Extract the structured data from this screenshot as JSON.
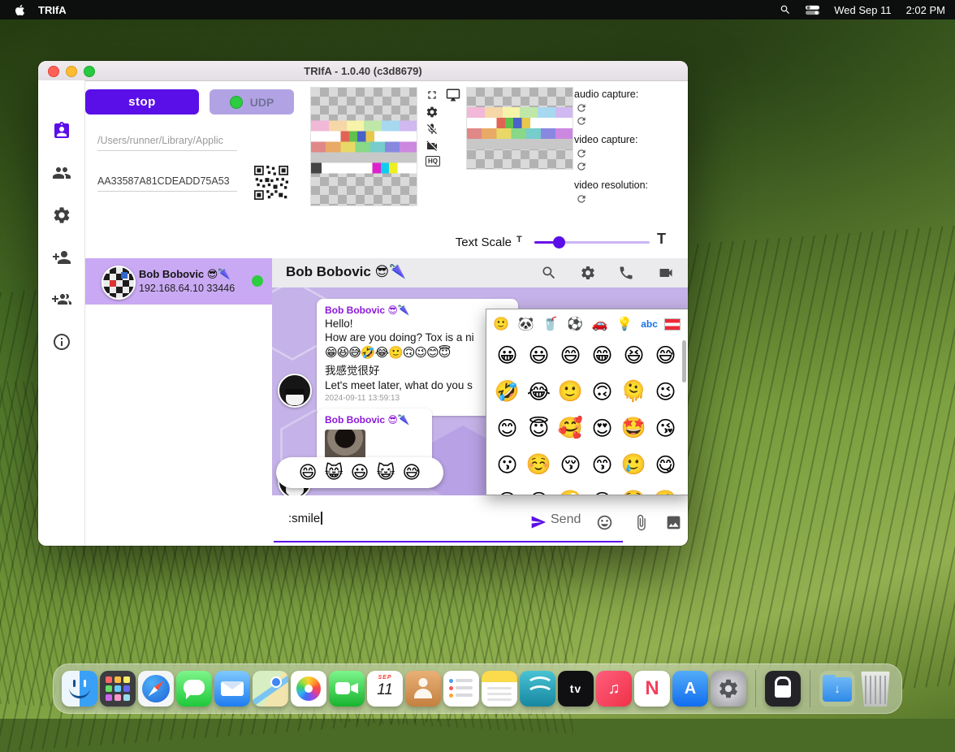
{
  "menubar": {
    "app_name": "TRIfA",
    "date": "Wed Sep 11",
    "time": "2:02 PM"
  },
  "window_title": "TRIfA - 1.0.40 (c3d8679)",
  "toolbar": {
    "stop_label": "stop",
    "udp_label": "UDP",
    "path_value": "/Users/runner/Library/Applic",
    "toxid_value": "AA33587A81CDEADD75A53",
    "hq_label": "HQ",
    "audio_capture_label": "audio capture:",
    "video_capture_label": "video capture:",
    "video_resolution_label": "video resolution:",
    "text_scale_label": "Text Scale",
    "text_scale_small": "T",
    "text_scale_large": "T"
  },
  "contact": {
    "name": "Bob Bobovic 😎🌂",
    "address": "192.168.64.10 33446"
  },
  "chat": {
    "title": "Bob Bobovic 😎🌂",
    "message1": {
      "sender": "Bob Bobovic 😎🌂",
      "line1": "Hello!",
      "line2": "How are you doing? Tox is a ni",
      "emoji_line": "😁😆😅🤣😂🙂🙃😉😊😇",
      "line3": "我感觉很好",
      "line4": "Let's meet later, what do you s",
      "timestamp": "2024-09-11 13:59:13"
    },
    "message2": {
      "sender": "Bob Bobovic 😎🌂"
    },
    "suggestions": [
      "😄",
      "😸",
      "😃",
      "😺",
      "😅"
    ],
    "input_value": ":smile",
    "send_label": "Send"
  },
  "emoji_picker": {
    "categories": [
      "🙂",
      "🐼",
      "🥤",
      "⚽",
      "🚗",
      "💡",
      "abc",
      "austria-flag"
    ],
    "rows": [
      [
        "😀",
        "😃",
        "😄",
        "😁",
        "😆",
        "😅"
      ],
      [
        "🤣",
        "😂",
        "🙂",
        "🙃",
        "🫠",
        "😉"
      ],
      [
        "😊",
        "😇",
        "🥰",
        "😍",
        "🤩",
        "😘"
      ],
      [
        "😗",
        "☺️",
        "😚",
        "😙",
        "🥲",
        "😋"
      ],
      [
        "😛",
        "😜",
        "🤪",
        "😝",
        "🤑",
        "🤗"
      ]
    ]
  },
  "dock": {
    "apps": [
      "finder",
      "launchpad",
      "safari",
      "messages",
      "mail",
      "maps",
      "photos",
      "facetime",
      "calendar",
      "contacts",
      "reminders",
      "notes",
      "wave",
      "apple-tv",
      "music",
      "news",
      "app-store",
      "settings",
      "lock",
      "downloads",
      "trash"
    ],
    "calendar": {
      "month": "SEP",
      "day": "11"
    },
    "apple_tv_label": "tv",
    "news_label": "N",
    "app_store_label": "A"
  },
  "colors": {
    "accent_purple": "#5a0fe8",
    "selection_purple": "#c9a9f3",
    "chat_background": "#c5b2e8",
    "online_green": "#2ecc40"
  }
}
